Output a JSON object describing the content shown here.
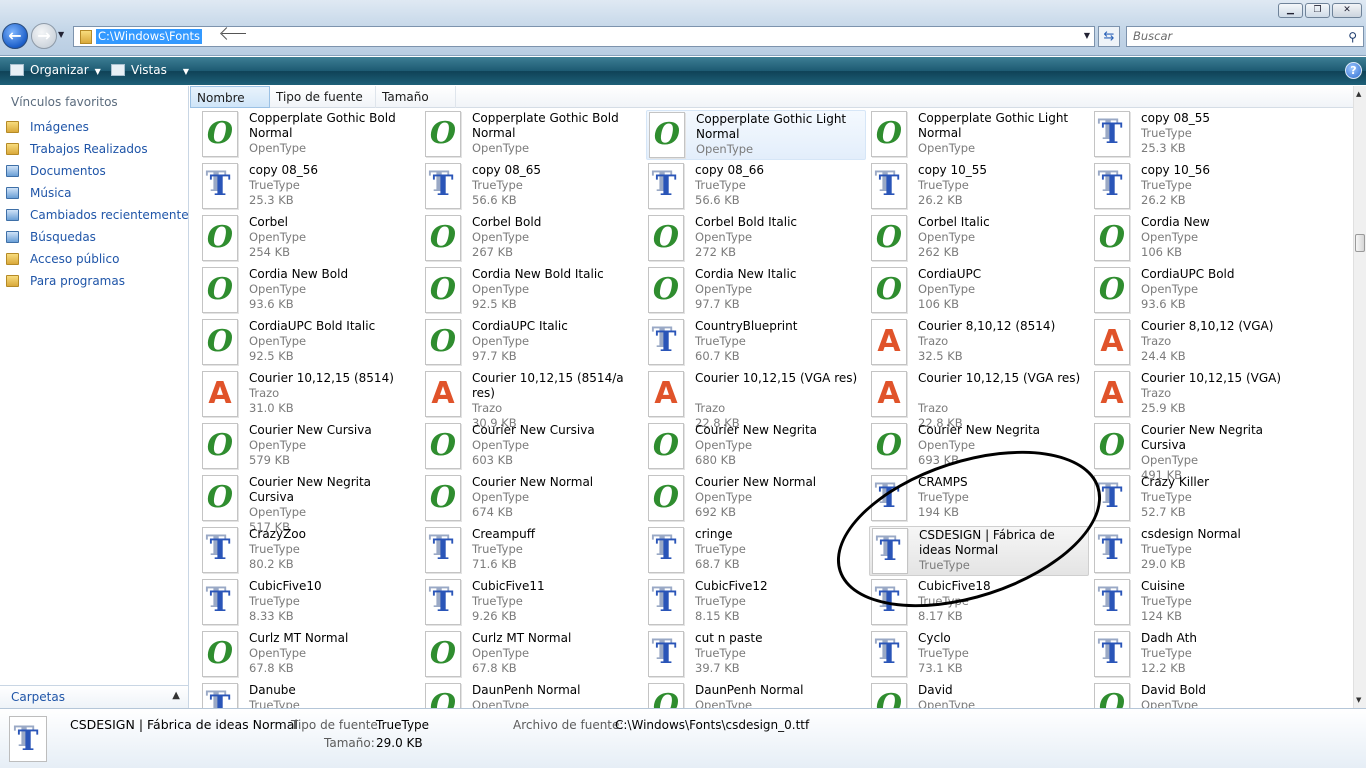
{
  "window": {
    "address": "C:\\Windows\\Fonts",
    "search_placeholder": "Buscar"
  },
  "toolbar": {
    "organize": "Organizar",
    "views": "Vistas"
  },
  "nav": {
    "header": "Vínculos favoritos",
    "items": [
      "Imágenes",
      "Trabajos Realizados",
      "Documentos",
      "Música",
      "Cambiados recientemente",
      "Búsquedas",
      "Acceso público",
      "Para programas"
    ],
    "folders": "Carpetas"
  },
  "columns": [
    "Nombre",
    "Tipo de fuente",
    "Tamaño"
  ],
  "fonts": [
    {
      "name": "Copperplate Gothic Bold Normal",
      "type": "OpenType",
      "size": "",
      "icon": "o"
    },
    {
      "name": "Copperplate Gothic Bold Normal",
      "type": "OpenType",
      "size": "",
      "icon": "o"
    },
    {
      "name": "Copperplate Gothic Light Normal",
      "type": "OpenType",
      "size": "",
      "icon": "o"
    },
    {
      "name": "Copperplate Gothic Light Normal",
      "type": "OpenType",
      "size": "",
      "icon": "o"
    },
    {
      "name": "copy 08_55",
      "type": "TrueType",
      "size": "25.3 KB",
      "icon": "t"
    },
    {
      "name": "copy 08_56",
      "type": "TrueType",
      "size": "25.3 KB",
      "icon": "t"
    },
    {
      "name": "copy 08_65",
      "type": "TrueType",
      "size": "56.6 KB",
      "icon": "t"
    },
    {
      "name": "copy 08_66",
      "type": "TrueType",
      "size": "56.6 KB",
      "icon": "t"
    },
    {
      "name": "copy 10_55",
      "type": "TrueType",
      "size": "26.2 KB",
      "icon": "t"
    },
    {
      "name": "copy 10_56",
      "type": "TrueType",
      "size": "26.2 KB",
      "icon": "t"
    },
    {
      "name": "Corbel",
      "type": "OpenType",
      "size": "254 KB",
      "icon": "o"
    },
    {
      "name": "Corbel Bold",
      "type": "OpenType",
      "size": "267 KB",
      "icon": "o"
    },
    {
      "name": "Corbel Bold Italic",
      "type": "OpenType",
      "size": "272 KB",
      "icon": "o"
    },
    {
      "name": "Corbel Italic",
      "type": "OpenType",
      "size": "262 KB",
      "icon": "o"
    },
    {
      "name": "Cordia New",
      "type": "OpenType",
      "size": "106 KB",
      "icon": "o"
    },
    {
      "name": "Cordia New Bold",
      "type": "OpenType",
      "size": "93.6 KB",
      "icon": "o"
    },
    {
      "name": "Cordia New Bold Italic",
      "type": "OpenType",
      "size": "92.5 KB",
      "icon": "o"
    },
    {
      "name": "Cordia New Italic",
      "type": "OpenType",
      "size": "97.7 KB",
      "icon": "o"
    },
    {
      "name": "CordiaUPC",
      "type": "OpenType",
      "size": "106 KB",
      "icon": "o"
    },
    {
      "name": "CordiaUPC Bold",
      "type": "OpenType",
      "size": "93.6 KB",
      "icon": "o"
    },
    {
      "name": "CordiaUPC Bold Italic",
      "type": "OpenType",
      "size": "92.5 KB",
      "icon": "o"
    },
    {
      "name": "CordiaUPC Italic",
      "type": "OpenType",
      "size": "97.7 KB",
      "icon": "o"
    },
    {
      "name": "CountryBlueprint",
      "type": "TrueType",
      "size": "60.7 KB",
      "icon": "t"
    },
    {
      "name": "Courier 8,10,12 (8514)",
      "type": "Trazo",
      "size": "32.5 KB",
      "icon": "a"
    },
    {
      "name": "Courier 8,10,12 (VGA)",
      "type": "Trazo",
      "size": "24.4 KB",
      "icon": "a"
    },
    {
      "name": "Courier 10,12,15 (8514)",
      "type": "Trazo",
      "size": "31.0 KB",
      "icon": "a"
    },
    {
      "name": "Courier 10,12,15 (8514/a res)",
      "type": "Trazo",
      "size": "30.9 KB",
      "icon": "a"
    },
    {
      "name": "Courier 10,12,15 (VGA res)",
      "type": "Trazo",
      "size": "22.8 KB",
      "icon": "a"
    },
    {
      "name": "Courier 10,12,15 (VGA res)",
      "type": "Trazo",
      "size": "22.8 KB",
      "icon": "a"
    },
    {
      "name": "Courier 10,12,15 (VGA)",
      "type": "Trazo",
      "size": "25.9 KB",
      "icon": "a"
    },
    {
      "name": "Courier New Cursiva",
      "type": "OpenType",
      "size": "579 KB",
      "icon": "o"
    },
    {
      "name": "Courier New Cursiva",
      "type": "OpenType",
      "size": "603 KB",
      "icon": "o"
    },
    {
      "name": "Courier New Negrita",
      "type": "OpenType",
      "size": "680 KB",
      "icon": "o"
    },
    {
      "name": "Courier New Negrita",
      "type": "OpenType",
      "size": "693 KB",
      "icon": "o"
    },
    {
      "name": "Courier New Negrita Cursiva",
      "type": "OpenType",
      "size": "491 KB",
      "icon": "o"
    },
    {
      "name": "Courier New Negrita Cursiva",
      "type": "OpenType",
      "size": "517 KB",
      "icon": "o"
    },
    {
      "name": "Courier New Normal",
      "type": "OpenType",
      "size": "674 KB",
      "icon": "o"
    },
    {
      "name": "Courier New Normal",
      "type": "OpenType",
      "size": "692 KB",
      "icon": "o"
    },
    {
      "name": "CRAMPS",
      "type": "TrueType",
      "size": "194 KB",
      "icon": "t"
    },
    {
      "name": "Crazy Killer",
      "type": "TrueType",
      "size": "52.7 KB",
      "icon": "t"
    },
    {
      "name": "CrazyZoo",
      "type": "TrueType",
      "size": "80.2 KB",
      "icon": "t"
    },
    {
      "name": "Creampuff",
      "type": "TrueType",
      "size": "71.6 KB",
      "icon": "t"
    },
    {
      "name": "cringe",
      "type": "TrueType",
      "size": "68.7 KB",
      "icon": "t"
    },
    {
      "name": "CSDESIGN | Fábrica de ideas Normal",
      "type": "TrueType",
      "size": "",
      "icon": "t"
    },
    {
      "name": "csdesign Normal",
      "type": "TrueType",
      "size": "29.0 KB",
      "icon": "t"
    },
    {
      "name": "CubicFive10",
      "type": "TrueType",
      "size": "8.33 KB",
      "icon": "t"
    },
    {
      "name": "CubicFive11",
      "type": "TrueType",
      "size": "9.26 KB",
      "icon": "t"
    },
    {
      "name": "CubicFive12",
      "type": "TrueType",
      "size": "8.15 KB",
      "icon": "t"
    },
    {
      "name": "CubicFive18",
      "type": "TrueType",
      "size": "8.17 KB",
      "icon": "t"
    },
    {
      "name": "Cuisine",
      "type": "TrueType",
      "size": "124 KB",
      "icon": "t"
    },
    {
      "name": "Curlz MT Normal",
      "type": "OpenType",
      "size": "67.8 KB",
      "icon": "o"
    },
    {
      "name": "Curlz MT Normal",
      "type": "OpenType",
      "size": "67.8 KB",
      "icon": "o"
    },
    {
      "name": "cut n paste",
      "type": "TrueType",
      "size": "39.7 KB",
      "icon": "t"
    },
    {
      "name": "Cyclo",
      "type": "TrueType",
      "size": "73.1 KB",
      "icon": "t"
    },
    {
      "name": "Dadh Ath",
      "type": "TrueType",
      "size": "12.2 KB",
      "icon": "t"
    },
    {
      "name": "Danube",
      "type": "TrueType",
      "size": "",
      "icon": "t"
    },
    {
      "name": "DaunPenh Normal",
      "type": "OpenType",
      "size": "",
      "icon": "o"
    },
    {
      "name": "DaunPenh Normal",
      "type": "OpenType",
      "size": "",
      "icon": "o"
    },
    {
      "name": "David",
      "type": "OpenType",
      "size": "",
      "icon": "o"
    },
    {
      "name": "David Bold",
      "type": "OpenType",
      "size": "",
      "icon": "o"
    }
  ],
  "details": {
    "name": "CSDESIGN | Fábrica de ideas Normal",
    "type_label": "Tipo de fuente:",
    "type_value": "TrueType",
    "size_label": "Tamaño:",
    "size_value": "29.0 KB",
    "file_label": "Archivo de fuente:",
    "file_value": "C:\\Windows\\Fonts\\csdesign_0.ttf"
  }
}
